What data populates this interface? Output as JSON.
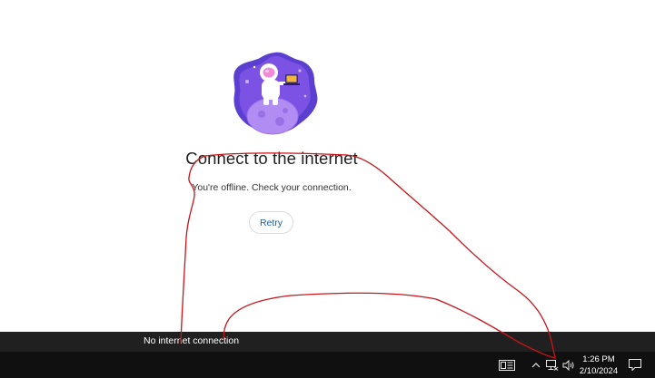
{
  "main": {
    "title": "Connect to the internet",
    "subtitle": "You're offline. Check your connection.",
    "retry_label": "Retry",
    "illustration": "astronaut-offline-illustration"
  },
  "banner": {
    "text": "No internet connection"
  },
  "taskbar": {
    "time": "1:26 PM",
    "date": "2/10/2024",
    "icons": [
      "news-widget-icon",
      "chevron-up-icon",
      "network-disconnected-icon",
      "volume-icon",
      "notifications-icon"
    ]
  },
  "colors": {
    "retry_text": "#1a5fa6",
    "taskbar": "#101010",
    "banner": "#202020",
    "annotation": "#c8151a",
    "illustration_purple": "#5b3fd0"
  }
}
